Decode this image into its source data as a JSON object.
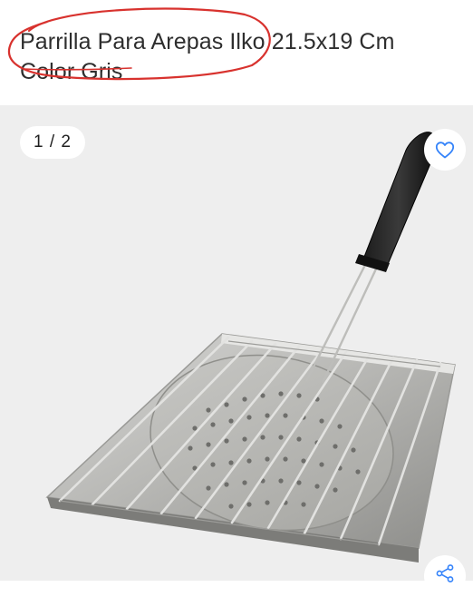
{
  "product": {
    "title": "Parrilla Para Arepas Ilko 21.5x19 Cm Color Gris"
  },
  "gallery": {
    "counter": "1 / 2"
  },
  "icons": {
    "favorite": "heart-outline-icon",
    "share": "share-icon"
  },
  "colors": {
    "accent": "#3483fa",
    "annotation": "#d8322e",
    "gallery_background": "#eeeeee",
    "title_text": "#2e2e2e"
  }
}
